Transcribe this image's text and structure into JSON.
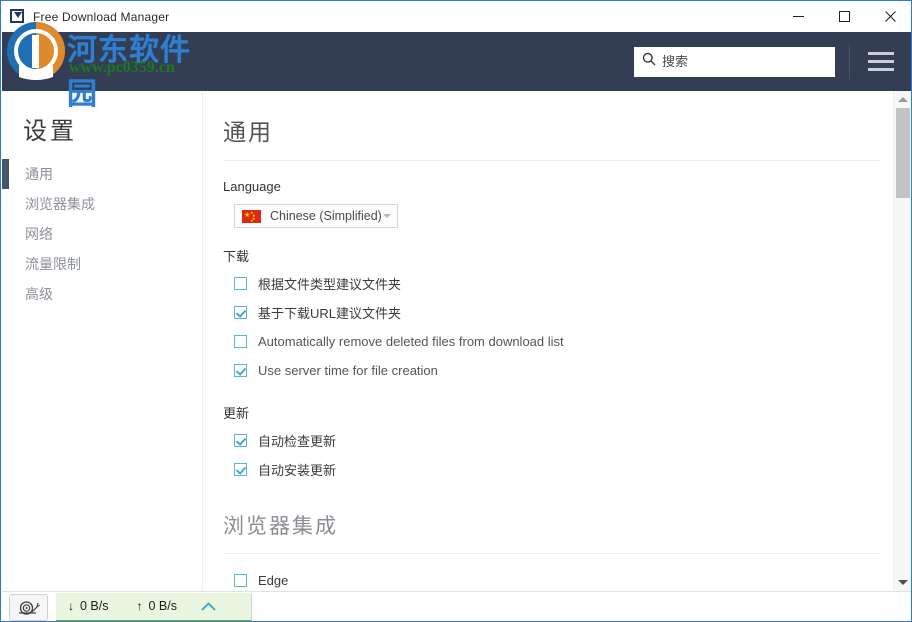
{
  "titlebar": {
    "app_title": "Free Download Manager",
    "app_icon": "download-app-icon",
    "minimize_label": "minimize-icon",
    "maximize_label": "maximize-icon",
    "close_label": "close-icon"
  },
  "watermark": {
    "site_name": "河东软件园",
    "site_url": "www.pc0359.cn"
  },
  "header": {
    "search_placeholder": "搜索",
    "search_value": "",
    "search_icon": "search-icon",
    "menu_icon": "hamburger-menu-icon"
  },
  "sidebar": {
    "title": "设置",
    "items": [
      {
        "label": "通用",
        "active": true
      },
      {
        "label": "浏览器集成",
        "active": false
      },
      {
        "label": "网络",
        "active": false
      },
      {
        "label": "流量限制",
        "active": false
      },
      {
        "label": "高级",
        "active": false
      }
    ]
  },
  "content": {
    "page_title": "通用",
    "language": {
      "label": "Language",
      "selected": "Chinese (Simplified)",
      "flag": "china-flag-icon"
    },
    "download": {
      "label": "下载",
      "options": [
        {
          "label": "根据文件类型建议文件夹",
          "checked": false
        },
        {
          "label": "基于下载URL建议文件夹",
          "checked": true
        },
        {
          "label": "Automatically remove deleted files from download list",
          "checked": false
        },
        {
          "label": "Use server time for file creation",
          "checked": true
        }
      ]
    },
    "update": {
      "label": "更新",
      "options": [
        {
          "label": "自动检查更新",
          "checked": true
        },
        {
          "label": "自动安装更新",
          "checked": true
        }
      ]
    },
    "browser_integration": {
      "title": "浏览器集成",
      "options": [
        {
          "label": "Edge",
          "checked": false
        }
      ]
    }
  },
  "scrollbar": {
    "up_arrow": "scroll-up-arrow-icon",
    "down_arrow": "scroll-down-arrow-icon"
  },
  "statusbar": {
    "speed_limit_icon": "snail-icon",
    "download_speed": "0 B/s",
    "upload_speed": "0 B/s",
    "download_arrow": "↓",
    "upload_arrow": "↑",
    "expander_icon": "chevron-up-icon"
  },
  "colors": {
    "header_bg": "#333d53",
    "accent_border": "#2b7cd3",
    "checkbox_border": "#5cb3d6",
    "status_green": "#67b32e",
    "watermark_blue": "#2f7fd1",
    "watermark_green": "#1b7a1b"
  }
}
